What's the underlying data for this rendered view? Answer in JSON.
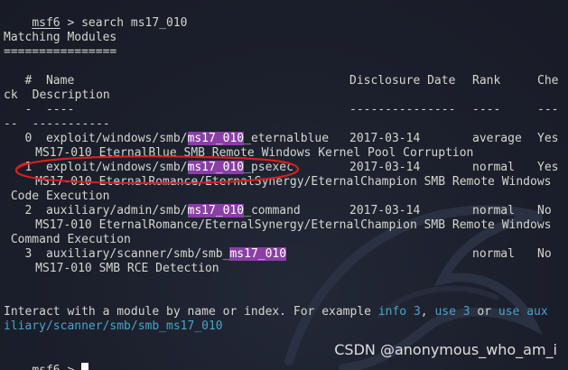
{
  "terminal": {
    "prompt_name": "msf6",
    "prompt_symbol": " > ",
    "command": "search ms17_010",
    "section_title": "Matching Modules",
    "section_rule": "================",
    "headers": {
      "line1_num": "   #  ",
      "line1_name": "Name",
      "disclosure": "Disclosure Date",
      "rank": "Rank",
      "check_line1": "Che",
      "check_line2": "ck",
      "description": "  Description",
      "dash_num": "   -  ",
      "dash_name": "----",
      "dash_disclosure": "---------------",
      "dash_rank": "----",
      "dash_check": "---",
      "dash_check2": "--",
      "dash_desc": "  -----------"
    },
    "rows": [
      {
        "num": "   0  ",
        "name_prefix": "exploit/windows/smb/",
        "name_match": "ms17_010",
        "name_suffix": "_eternalblue",
        "date": "2017-03-14",
        "rank": "average",
        "check": "Yes",
        "description": "     MS17-010 EternalBlue SMB Remote Windows Kernel Pool Corruption",
        "description_cont": ""
      },
      {
        "num": "   1  ",
        "name_prefix": "exploit/windows/smb/",
        "name_match": "ms17_010",
        "name_suffix": "_psexec",
        "date": "2017-03-14",
        "rank": "normal",
        "check": "Yes",
        "description": "     MS17-010 EternalRomance/EternalSynergy/EternalChampion SMB Remote Windows",
        "description_cont": " Code Execution"
      },
      {
        "num": "   2  ",
        "name_prefix": "auxiliary/admin/smb/",
        "name_match": "ms17_010",
        "name_suffix": "_command",
        "date": "2017-03-14",
        "rank": "normal",
        "check": "No",
        "description": "     MS17-010 EternalRomance/EternalSynergy/EternalChampion SMB Remote Windows",
        "description_cont": " Command Execution"
      },
      {
        "num": "   3  ",
        "name_prefix": "auxiliary/scanner/smb/smb_",
        "name_match": "ms17_010",
        "name_suffix": "",
        "date": "",
        "rank": "normal",
        "check": "No",
        "description": "     MS17-010 SMB RCE Detection",
        "description_cont": ""
      }
    ],
    "interact": {
      "text1": "Interact with a module by name or index. For example ",
      "info": "info 3",
      "sep": ", ",
      "use": "use 3",
      "or": " or ",
      "use_aux": "use aux",
      "line2": "iliary/scanner/smb/smb_ms17_010"
    },
    "final_prompt_name": "msf6",
    "final_prompt_symbol": " > "
  },
  "watermark": "CSDN @anonymous_who_am_i",
  "colors": {
    "background": "#1b1f2b",
    "text": "#d3d7cf",
    "highlight": "#8a3fa6",
    "command_cyan": "#4aa3c9",
    "annotation_red": "#d61f1f"
  },
  "icons": {
    "cursor": "block-cursor-icon",
    "dragon": "kali-dragon-watermark"
  }
}
